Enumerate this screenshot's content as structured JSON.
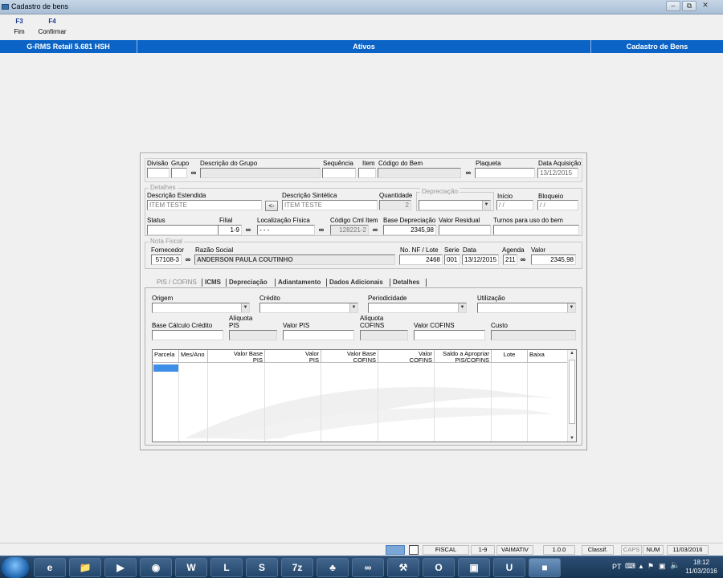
{
  "window": {
    "title": "Cadastro de bens"
  },
  "fkeys": [
    {
      "key": "F3",
      "label": "Fim"
    },
    {
      "key": "F4",
      "label": "Confirmar"
    }
  ],
  "header": {
    "app": "G-RMS Retail 5.681 HSH",
    "module": "Ativos",
    "screen": "Cadastro de Bens"
  },
  "form": {
    "row1": {
      "divisao_label": "Divisão",
      "divisao": "",
      "grupo_label": "Grupo",
      "grupo": "",
      "descricao_grupo_label": "Descrição do Grupo",
      "descricao_grupo": "",
      "sequencia_label": "Sequência",
      "sequencia": "",
      "item_label": "Item",
      "item": "",
      "codigo_bem_label": "Código do Bem",
      "codigo_bem": "",
      "plaqueta_label": "Plaqueta",
      "plaqueta": "",
      "data_aquisicao_label": "Data Aquisição",
      "data_aquisicao": "13/12/2015"
    },
    "detalhes": {
      "caption": "Detalhes",
      "descricao_estendida_label": "Descrição Estendida",
      "descricao_estendida": "ITEM TESTE",
      "copy_button": "<-",
      "descricao_sintetica_label": "Descrição Sintética",
      "descricao_sintetica": "ITEM TESTE",
      "quantidade_label": "Quantidade",
      "quantidade": "2",
      "depreciacao_caption": "Depreciação",
      "inicio_label": "Início",
      "inicio": " / /",
      "bloqueio_label": "Bloqueio",
      "bloqueio": " / /",
      "status_label": "Status",
      "status": "",
      "filial_label": "Filial",
      "filial": "1-9",
      "localizacao_label": "Localização Física",
      "localizacao": " -  -  -",
      "codigo_cml_label": "Código Cml Item",
      "codigo_cml": "128221-2",
      "base_depreciacao_label": "Base Depreciação",
      "base_depreciacao": "2345,98",
      "valor_residual_label": "Valor Residual",
      "valor_residual": "",
      "turnos_label": "Turnos para uso do bem",
      "turnos": ""
    },
    "nota_fiscal": {
      "caption": "Nota Fiscal",
      "fornecedor_label": "Fornecedor",
      "fornecedor": "57108-3",
      "razao_social_label": "Razão Social",
      "razao_social": "ANDERSON PAULA COUTINHO",
      "nf_lote_label": "No. NF / Lote",
      "nf_lote": "2468",
      "serie_label": "Serie",
      "serie": "001",
      "data_label": "Data",
      "data": "13/12/2015",
      "agenda_label": "Agenda",
      "agenda": "211",
      "valor_label": "Valor",
      "valor": "2345,98"
    },
    "tabs": [
      "PIS / COFINS",
      "ICMS",
      "Depreciação",
      "Adiantamento",
      "Dados Adicionais",
      "Detalhes"
    ],
    "pis": {
      "origem_label": "Origem",
      "credito_label": "Crédito",
      "periodicidade_label": "Periodicidade",
      "utilizacao_label": "Utilização",
      "base_calculo_label": "Base Cálculo Crédito",
      "aliquota_pis_label_1": "Alíquota",
      "aliquota_pis_label_2": "PIS",
      "valor_pis_label": "Valor PIS",
      "aliquota_cofins_label_1": "Alíquota",
      "aliquota_cofins_label_2": "COFINS",
      "valor_cofins_label": "Valor COFINS",
      "custo_label": "Custo"
    },
    "grid_headers": [
      {
        "l1": "",
        "l2": "Parcela"
      },
      {
        "l1": "",
        "l2": "Mes/Ano"
      },
      {
        "l1": "Valor Base",
        "l2": "PIS"
      },
      {
        "l1": "Valor",
        "l2": "PIS"
      },
      {
        "l1": "Valor Base",
        "l2": "COFINS"
      },
      {
        "l1": "Valor",
        "l2": "COFINS"
      },
      {
        "l1": "Saldo a Apropriar",
        "l2": "PIS/COFINS"
      },
      {
        "l1": "",
        "l2": "Lote"
      },
      {
        "l1": "",
        "l2": "Baixa"
      }
    ]
  },
  "statusbar": {
    "items": [
      "FISCAL",
      "1-9",
      "VAIMATIV",
      "1.0.0",
      "Classif.",
      "CAPS",
      "NUM",
      "11/03/2016"
    ]
  },
  "taskbar": {
    "lang": "PT",
    "time": "18:12",
    "date": "11/03/2016"
  }
}
